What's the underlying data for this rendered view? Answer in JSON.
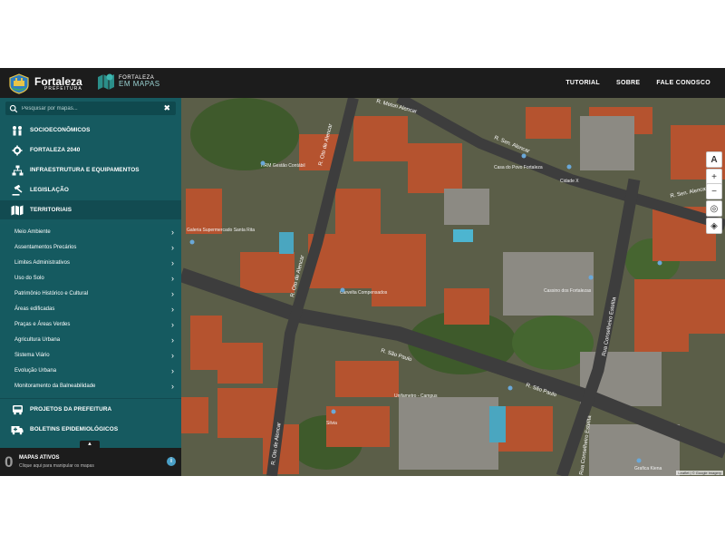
{
  "header": {
    "brand_name": "Fortaleza",
    "brand_sub": "PREFEITURA",
    "app_line1": "FORTALEZA",
    "app_line2": "EM MAPAS",
    "nav": [
      "TUTORIAL",
      "SOBRE",
      "FALE CONOSCO"
    ]
  },
  "search": {
    "placeholder": "Pesquisar por mapas..."
  },
  "categories": [
    {
      "label": "SOCIOECONÔMICOS",
      "icon": "people-icon"
    },
    {
      "label": "FORTALEZA 2040",
      "icon": "gear-icon"
    },
    {
      "label": "INFRAESTRUTURA E EQUIPAMENTOS",
      "icon": "network-icon"
    },
    {
      "label": "LEGISLAÇÃO",
      "icon": "gavel-icon"
    },
    {
      "label": "TERRITORIAIS",
      "icon": "map-icon"
    }
  ],
  "territoriais_items": [
    "Meio Ambiente",
    "Assentamentos Precários",
    "Limites Administrativos",
    "Uso do Solo",
    "Patrimônio Histórico e Cultural",
    "Áreas edificadas",
    "Praças e Áreas Verdes",
    "Agricultura Urbana",
    "Sistema Viário",
    "Evolução Urbana",
    "Monitoramento da Balneabilidade"
  ],
  "bottom_categories": [
    {
      "label": "PROJETOS DA PREFEITURA",
      "icon": "bus-icon"
    },
    {
      "label": "BOLETINS EPIDEMIOLÓGICOS",
      "icon": "ambulance-icon"
    }
  ],
  "active_maps": {
    "count": "0",
    "title": "MAPAS ATIVOS",
    "subtitle": "Clique aqui para manipular os mapas"
  },
  "map": {
    "streets": [
      "R. Oto de Alencar",
      "R. Oto de Alencar",
      "R. Oto de Alencar",
      "R. São Paulo",
      "R. São Paulo",
      "Rua Conselheiro Estelita",
      "Rua Conselheiro Estelita",
      "R. Sen. Alencar",
      "R. Sen. Alencar",
      "R. Meton Alencar"
    ],
    "places": [
      "HRM Gestão Contábil",
      "Galeria Supermercado Santa Rita",
      "Carvelta Compensados",
      "Casa do Povo Fortaleza",
      "Cassino dos Fortalezas",
      "Unifametro - Campus",
      "Cidade X",
      "Grafica Kiena",
      "Silvia"
    ],
    "attribution": "Leaflet | © Google imagery"
  }
}
